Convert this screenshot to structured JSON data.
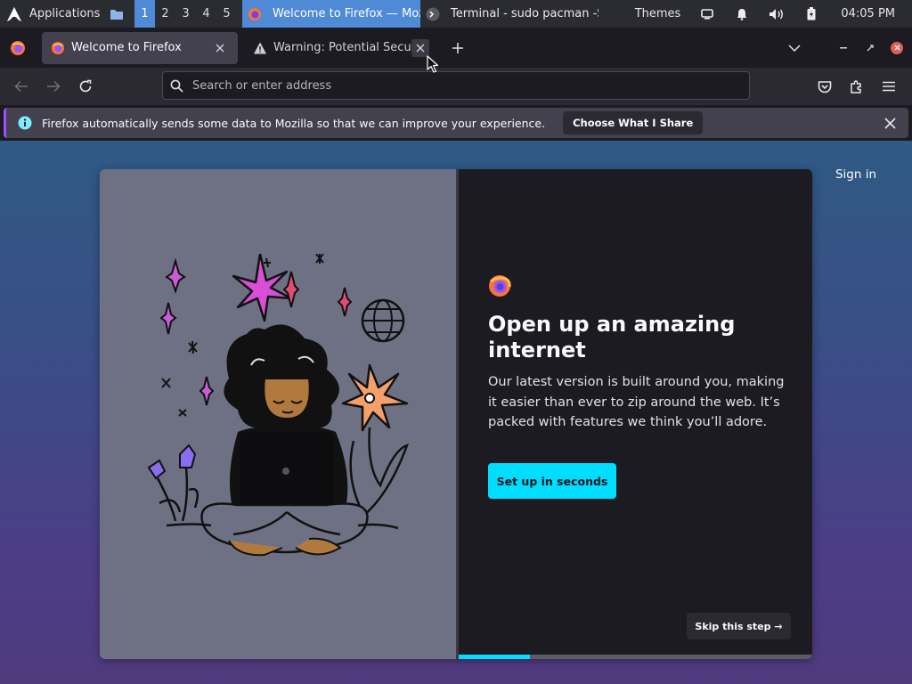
{
  "panel": {
    "apps_label": "Applications",
    "workspaces": [
      "1",
      "2",
      "3",
      "4",
      "5"
    ],
    "active_workspace": "1",
    "tasks": [
      {
        "label": "Welcome to Firefox — Mozill...",
        "icon": "firefox-icon",
        "active": true
      },
      {
        "label": "Terminal - sudo pacman -Sy ...",
        "icon": "terminal-icon",
        "active": false
      }
    ],
    "themes_label": "Themes",
    "clock": "04:05 PM"
  },
  "tabs": [
    {
      "title": "Welcome to Firefox",
      "icon": "firefox-icon",
      "selected": true
    },
    {
      "title": "Warning: Potential Security Risk Ahead",
      "icon": "warning-icon",
      "selected": false
    }
  ],
  "navbar": {
    "url_placeholder": "Search or enter address"
  },
  "notification": {
    "text": "Firefox automatically sends some data to Mozilla so that we can improve your experience.",
    "button_label": "Choose What I Share"
  },
  "page": {
    "sign_in": "Sign in",
    "title": "Open up an amazing internet",
    "body": "Our latest version is built around you, making it easier than ever to zip around the web. It’s packed with features we think you’ll adore.",
    "cta_label": "Set up in seconds",
    "skip_label": "Skip this step →",
    "progress": 0.2
  },
  "colors": {
    "accent": "#00ddff",
    "panel_active": "#4f8ad6",
    "card_dark": "#1c1b22",
    "card_left": "#6d7183"
  }
}
